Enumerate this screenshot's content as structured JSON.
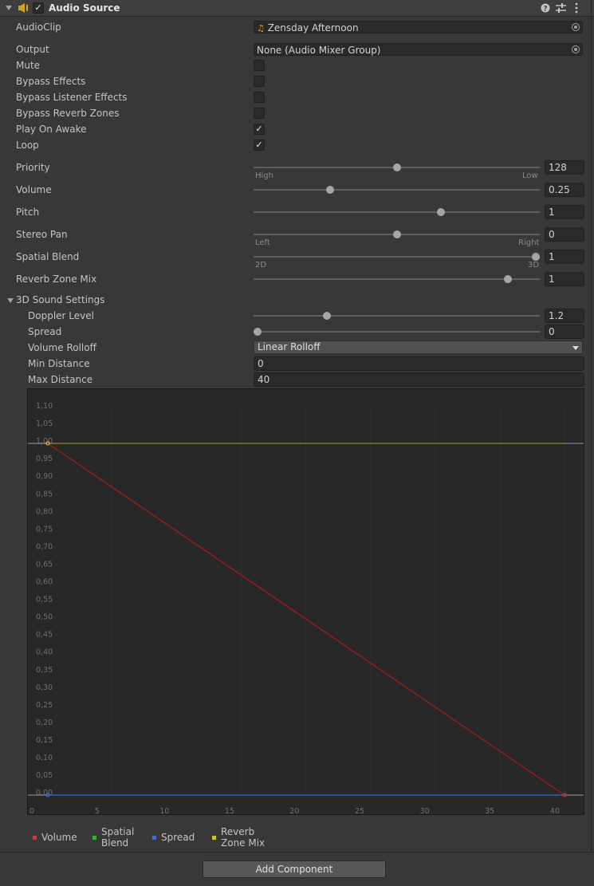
{
  "header": {
    "title": "Audio Source",
    "enabled": true
  },
  "fields": {
    "audioclip_label": "AudioClip",
    "audioclip_value": "Zensday Afternoon",
    "output_label": "Output",
    "output_value": "None (Audio Mixer Group)",
    "mute_label": "Mute",
    "mute_checked": false,
    "bypass_effects_label": "Bypass Effects",
    "bypass_effects_checked": false,
    "bypass_listener_label": "Bypass Listener Effects",
    "bypass_listener_checked": false,
    "bypass_reverb_label": "Bypass Reverb Zones",
    "bypass_reverb_checked": false,
    "play_on_awake_label": "Play On Awake",
    "play_on_awake_checked": true,
    "loop_label": "Loop",
    "loop_checked": true,
    "check_glyph": "✓"
  },
  "sliders": {
    "priority": {
      "label": "Priority",
      "value": "128",
      "level": 0.5,
      "left": "High",
      "right": "Low"
    },
    "volume": {
      "label": "Volume",
      "value": "0.25",
      "level": 0.26
    },
    "pitch": {
      "label": "Pitch",
      "value": "1",
      "level": 0.66
    },
    "stereo_pan": {
      "label": "Stereo Pan",
      "value": "0",
      "level": 0.5,
      "left": "Left",
      "right": "Right"
    },
    "spatial_blend": {
      "label": "Spatial Blend",
      "value": "1",
      "level": 1.0,
      "left": "2D",
      "right": "3D"
    },
    "reverb_zone_mix": {
      "label": "Reverb Zone Mix",
      "value": "1",
      "level": 0.9
    }
  },
  "sound3d": {
    "title": "3D Sound Settings",
    "doppler": {
      "label": "Doppler Level",
      "value": "1.2",
      "level": 0.25
    },
    "spread": {
      "label": "Spread",
      "value": "0",
      "level": 0.0
    },
    "rolloff_label": "Volume Rolloff",
    "rolloff_value": "Linear Rolloff",
    "min_distance_label": "Min Distance",
    "min_distance_value": "0",
    "max_distance_label": "Max Distance",
    "max_distance_value": "40"
  },
  "graph": {
    "y_ticks": [
      "1,10",
      "1,05",
      "1,00",
      "0,95",
      "0,90",
      "0,85",
      "0,80",
      "0,75",
      "0,70",
      "0,65",
      "0,60",
      "0,55",
      "0,50",
      "0,45",
      "0,40",
      "0,35",
      "0,30",
      "0,25",
      "0,20",
      "0,15",
      "0,10",
      "0,05",
      "0,00"
    ],
    "x_ticks": [
      "0",
      "5",
      "10",
      "15",
      "20",
      "25",
      "30",
      "35",
      "40"
    ],
    "colors": {
      "volume": "#a01c1c",
      "spatial_blend": "#2a9a2a",
      "spread": "#2c5fc0",
      "reverb": "#a0a020",
      "grid": "#2f2f2f",
      "axis": "#9a9a9a"
    }
  },
  "legend": [
    {
      "name": "Volume",
      "color": "#d9382f"
    },
    {
      "name": "Spatial Blend",
      "color": "#35b035"
    },
    {
      "name": "Spread",
      "color": "#3a6fd8"
    },
    {
      "name": "Reverb Zone Mix",
      "color": "#c8c832"
    }
  ],
  "add_component": "Add Component"
}
